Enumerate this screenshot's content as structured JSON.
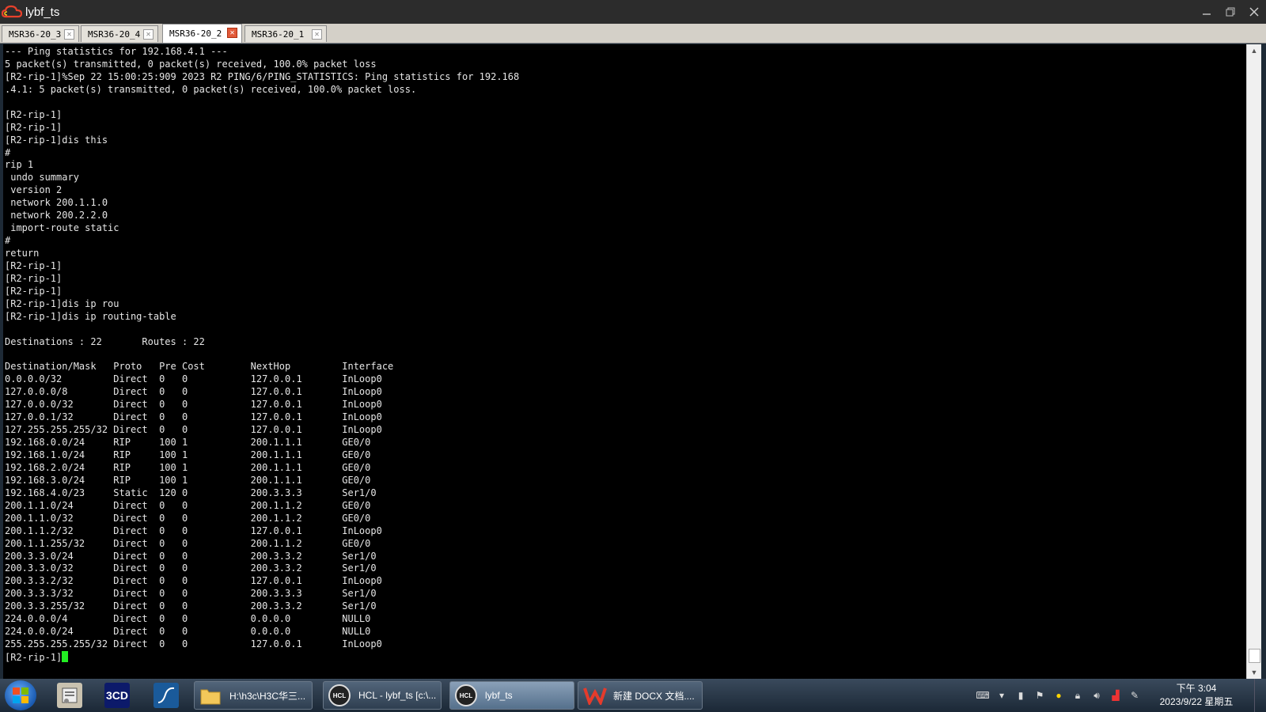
{
  "window": {
    "title": "lybf_ts"
  },
  "tabs": [
    {
      "label": "MSR36-20_3",
      "active": false
    },
    {
      "label": "MSR36-20_4",
      "active": false
    },
    {
      "label": "MSR36-20_2",
      "active": true
    },
    {
      "label": "MSR36-20_1",
      "active": false
    }
  ],
  "terminal": {
    "lines": [
      "--- Ping statistics for 192.168.4.1 ---",
      "5 packet(s) transmitted, 0 packet(s) received, 100.0% packet loss",
      "[R2-rip-1]%Sep 22 15:00:25:909 2023 R2 PING/6/PING_STATISTICS: Ping statistics for 192.168",
      ".4.1: 5 packet(s) transmitted, 0 packet(s) received, 100.0% packet loss.",
      "",
      "[R2-rip-1]",
      "[R2-rip-1]",
      "[R2-rip-1]dis this",
      "#",
      "rip 1",
      " undo summary",
      " version 2",
      " network 200.1.1.0",
      " network 200.2.2.0",
      " import-route static",
      "#",
      "return",
      "[R2-rip-1]",
      "[R2-rip-1]",
      "[R2-rip-1]",
      "[R2-rip-1]dis ip rou",
      "[R2-rip-1]dis ip routing-table",
      "",
      "Destinations : 22       Routes : 22",
      "",
      "Destination/Mask   Proto   Pre Cost        NextHop         Interface",
      "0.0.0.0/32         Direct  0   0           127.0.0.1       InLoop0",
      "127.0.0.0/8        Direct  0   0           127.0.0.1       InLoop0",
      "127.0.0.0/32       Direct  0   0           127.0.0.1       InLoop0",
      "127.0.0.1/32       Direct  0   0           127.0.0.1       InLoop0",
      "127.255.255.255/32 Direct  0   0           127.0.0.1       InLoop0",
      "192.168.0.0/24     RIP     100 1           200.1.1.1       GE0/0",
      "192.168.1.0/24     RIP     100 1           200.1.1.1       GE0/0",
      "192.168.2.0/24     RIP     100 1           200.1.1.1       GE0/0",
      "192.168.3.0/24     RIP     100 1           200.1.1.1       GE0/0",
      "192.168.4.0/23     Static  120 0           200.3.3.3       Ser1/0",
      "200.1.1.0/24       Direct  0   0           200.1.1.2       GE0/0",
      "200.1.1.0/32       Direct  0   0           200.1.1.2       GE0/0",
      "200.1.1.2/32       Direct  0   0           127.0.0.1       InLoop0",
      "200.1.1.255/32     Direct  0   0           200.1.1.2       GE0/0",
      "200.3.3.0/24       Direct  0   0           200.3.3.2       Ser1/0",
      "200.3.3.0/32       Direct  0   0           200.3.3.2       Ser1/0",
      "200.3.3.2/32       Direct  0   0           127.0.0.1       InLoop0",
      "200.3.3.3/32       Direct  0   0           200.3.3.3       Ser1/0",
      "200.3.3.255/32     Direct  0   0           200.3.3.2       Ser1/0",
      "224.0.0.0/4        Direct  0   0           0.0.0.0         NULL0",
      "224.0.0.0/24       Direct  0   0           0.0.0.0         NULL0",
      "255.255.255.255/32 Direct  0   0           127.0.0.1       InLoop0"
    ],
    "prompt": "[R2-rip-1]",
    "cursor_color": "#22ee22"
  },
  "taskbar": {
    "quick_launch": [
      {
        "icon": "file-manager-icon"
      },
      {
        "label": "3CD",
        "icon": "3cd-icon"
      },
      {
        "icon": "wireshark-icon"
      }
    ],
    "items": [
      {
        "label": "H:\\h3c\\H3C华三...",
        "icon": "folder-icon",
        "active": false
      },
      {
        "label": "HCL - lybf_ts [c:\\...",
        "icon": "hcl-icon",
        "active": false
      },
      {
        "label": "lybf_ts",
        "icon": "hcl-icon",
        "active": true
      },
      {
        "label": "新建 DOCX 文档....",
        "icon": "wps-icon",
        "active": false
      }
    ],
    "clock": {
      "time": "下午 3:04",
      "date": "2023/9/22 星期五"
    }
  },
  "colors": {
    "accent": "#e25a3a",
    "terminal_bg": "#000000",
    "terminal_fg": "#e6e6e6"
  }
}
